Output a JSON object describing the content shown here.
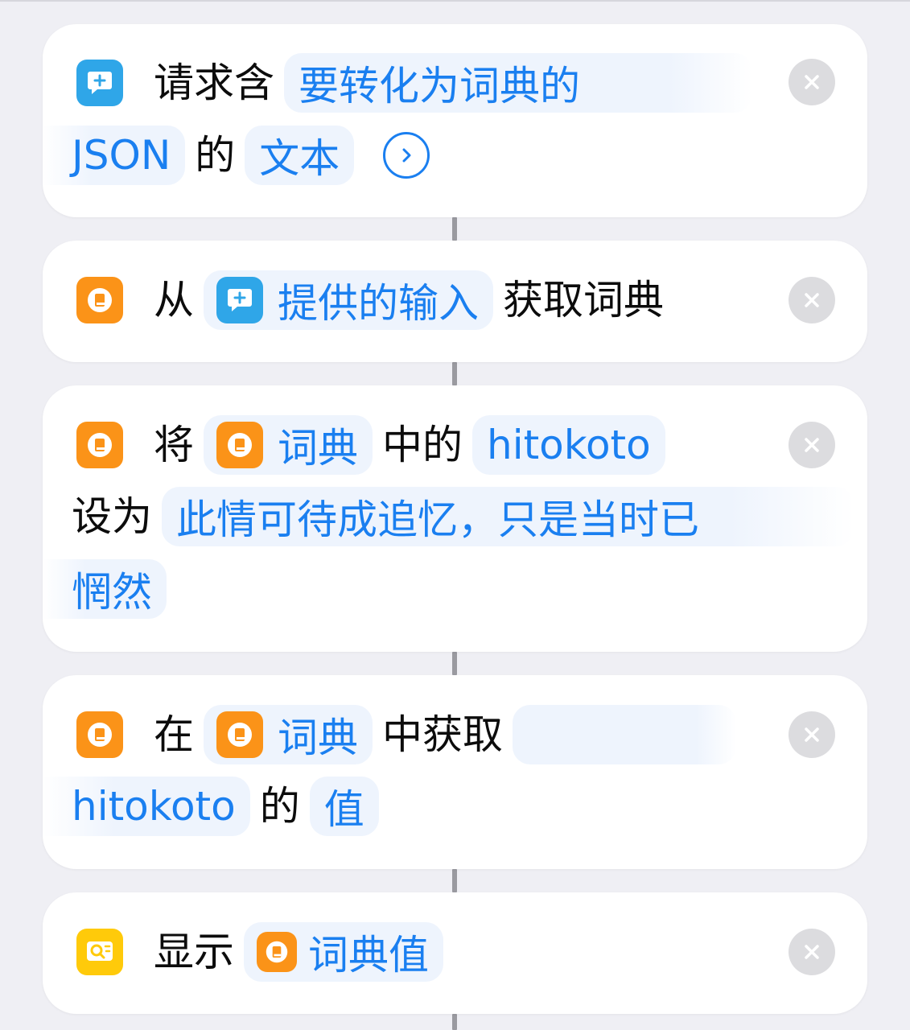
{
  "actions": [
    {
      "icon": "text-bubble-plus-icon",
      "prefix": "请求含",
      "input_token": "要转化为词典的",
      "input_token_cont": "JSON",
      "mid": "的",
      "type_token": "文本"
    },
    {
      "icon": "dictionary-icon",
      "prefix": "从",
      "source_token": "提供的输入",
      "suffix": "获取词典"
    },
    {
      "icon": "dictionary-icon",
      "prefix": "将",
      "dict_token": "词典",
      "mid": "中的",
      "key_token": "hitokoto",
      "set_label": "设为",
      "value_line1": "此情可待成追忆，只是当时已",
      "value_line2": "惘然"
    },
    {
      "icon": "dictionary-icon",
      "prefix": "在",
      "dict_token": "词典",
      "mid": "中获取",
      "key_token": "hitokoto",
      "of": "的",
      "value_token": "值"
    },
    {
      "icon": "show-result-icon",
      "prefix": "显示",
      "result_token": "词典值"
    }
  ],
  "colors": {
    "accent": "#1a7ff0",
    "token_bg": "#eef4fd",
    "blue_icon": "#2fa6e8",
    "orange_icon": "#fb9318",
    "yellow_icon": "#ffca0a",
    "background": "#efeff4"
  }
}
